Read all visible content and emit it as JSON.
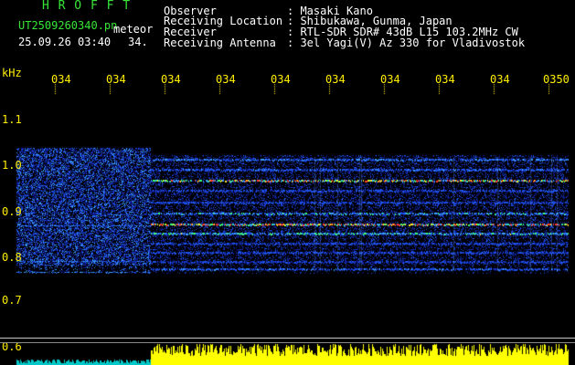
{
  "logo": "H R O F F T",
  "header": {
    "filename": "UT2509260340.pn",
    "tag": "meteor",
    "datetime": "25.09.26 03:40",
    "minute_label": "34.",
    "info": [
      {
        "label": "Observer",
        "value": ": Masaki Kano"
      },
      {
        "label": "Receiving Location",
        "value": ": Shibukawa, Gunma, Japan"
      },
      {
        "label": "Receiver",
        "value": ": RTL-SDR SDR# 43dB L15 103.2MHz CW"
      },
      {
        "label": "Receiving Antenna",
        "value": ": 3el Yagi(V) Az 330 for Vladivostok"
      }
    ]
  },
  "time_axis": {
    "labels": [
      "034",
      "034",
      "034",
      "034",
      "034",
      "034",
      "034",
      "034",
      "034",
      "0350"
    ]
  },
  "freq_axis": {
    "unit": "kHz",
    "ticks": [
      "1.1",
      "1.0",
      "0.9",
      "0.8",
      "0.7",
      "0.6"
    ]
  },
  "colors": {
    "background": "#000000",
    "text_white": "#ffffff",
    "text_green": "#37e637",
    "label_yellow": "#ffee00",
    "signal_bar": "#ffff00",
    "low_bar": "#00c8c8"
  }
}
